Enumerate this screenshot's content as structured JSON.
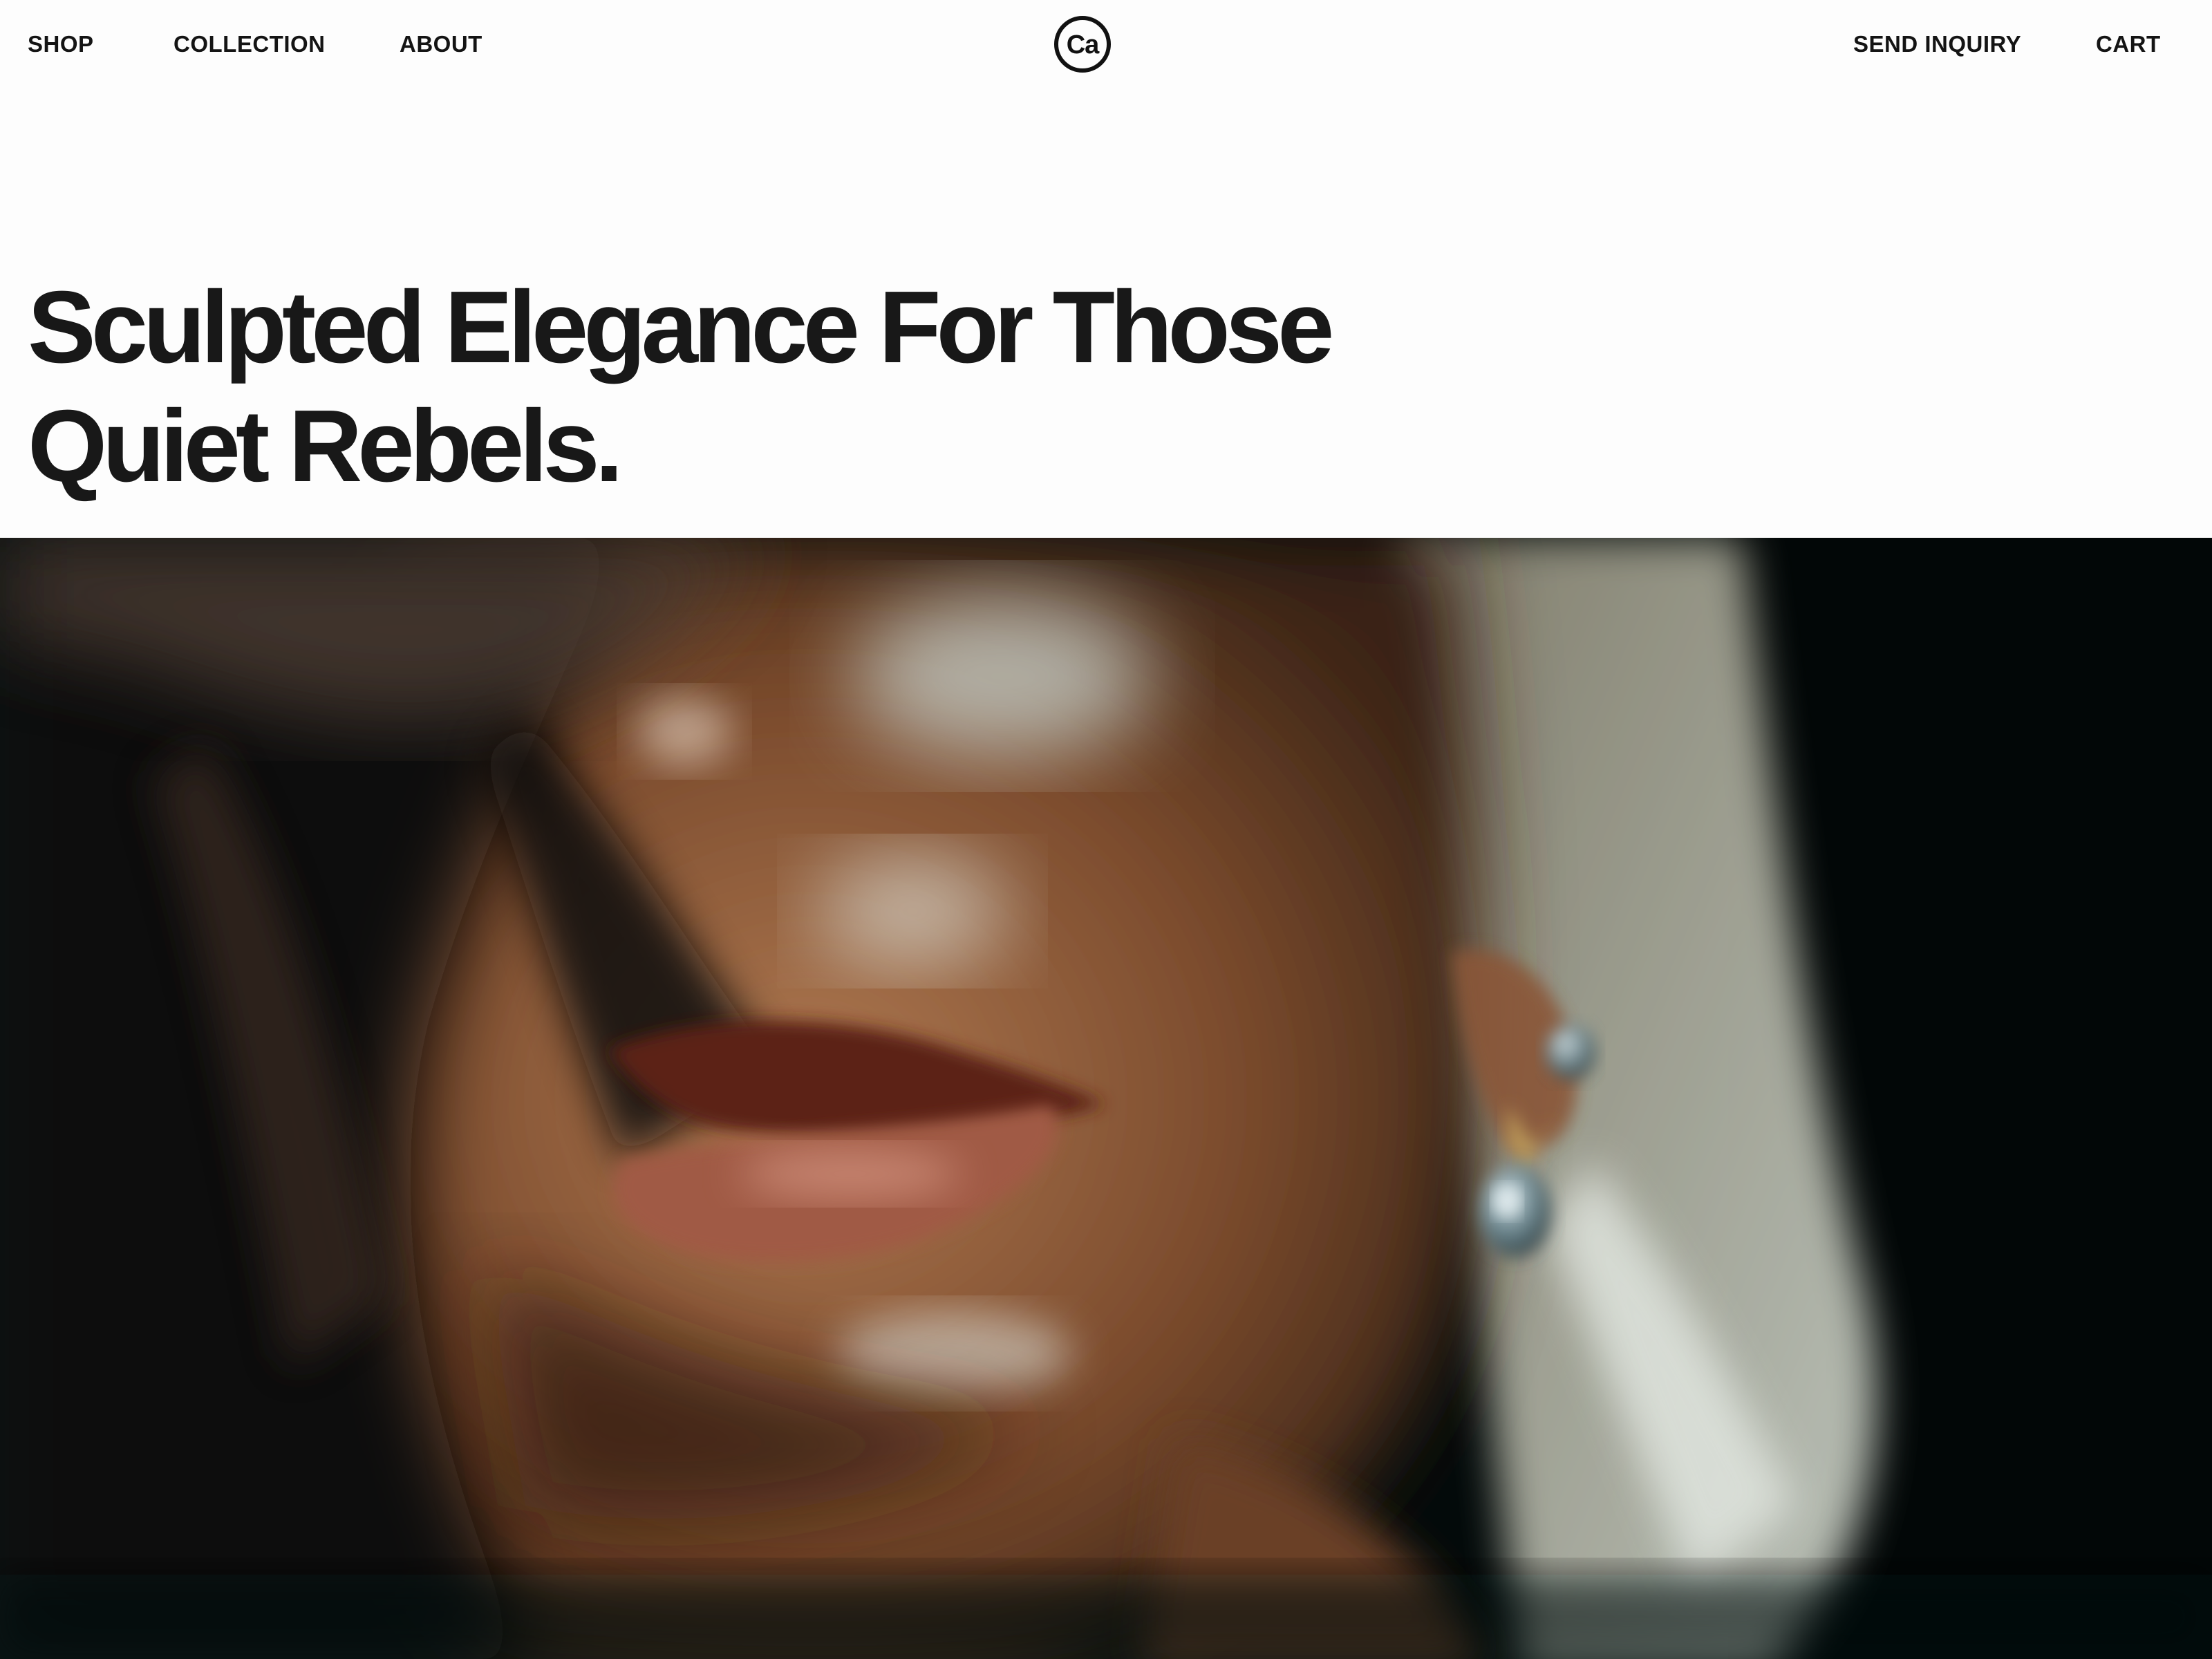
{
  "header": {
    "nav_left": [
      {
        "label": "SHOP"
      },
      {
        "label": "COLLECTION"
      },
      {
        "label": "ABOUT"
      }
    ],
    "logo": {
      "text": "Ca"
    },
    "nav_right": [
      {
        "label": "SEND INQUIRY"
      },
      {
        "label": "CART"
      }
    ]
  },
  "hero": {
    "title_line1": "Sculpted Elegance For Those",
    "title_line2": "Quiet Rebels."
  },
  "colors": {
    "background": "#fdfdfd",
    "text": "#161616",
    "image_dark": "#030a0a"
  }
}
